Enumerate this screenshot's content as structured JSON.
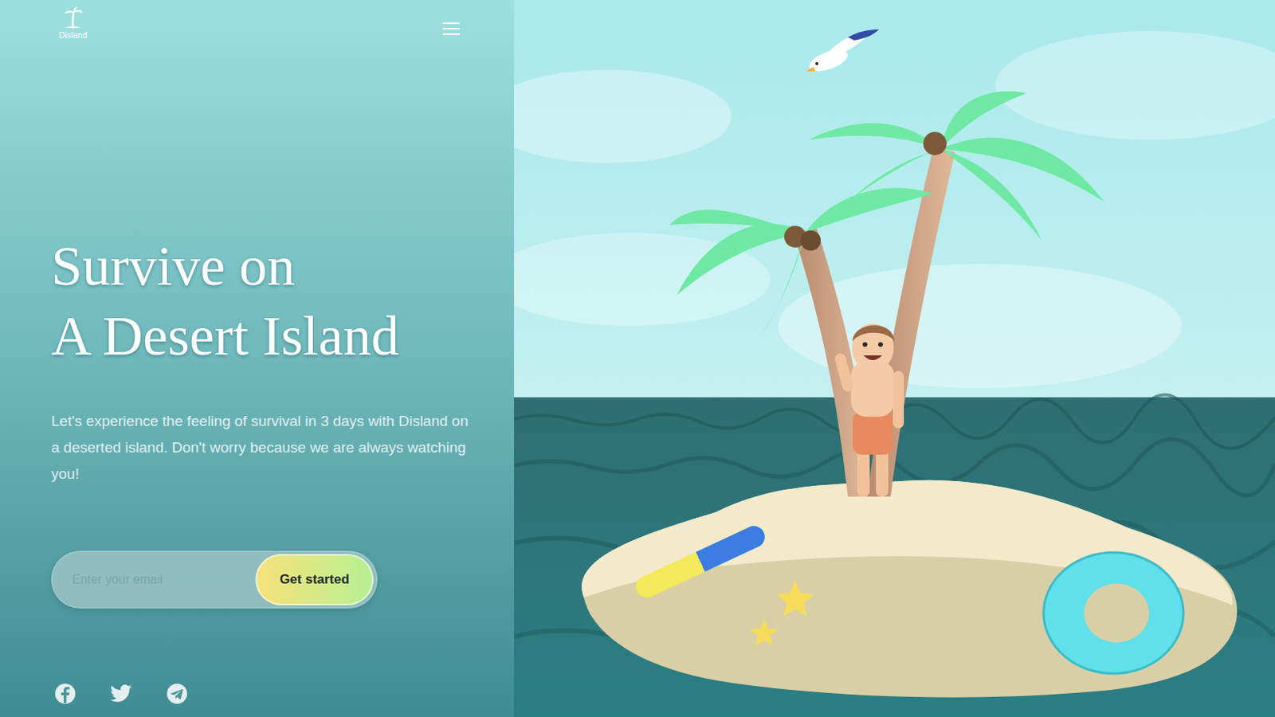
{
  "logo": {
    "text": "Disland"
  },
  "hero": {
    "title": [
      "Survive on",
      "A Desert Island"
    ],
    "description": "Let's experience the feeling of survival in 3 days with Disland on a deserted island. Don't worry because we are always watching you!"
  },
  "signup": {
    "placeholder": "Enter your email",
    "button": "Get started"
  }
}
